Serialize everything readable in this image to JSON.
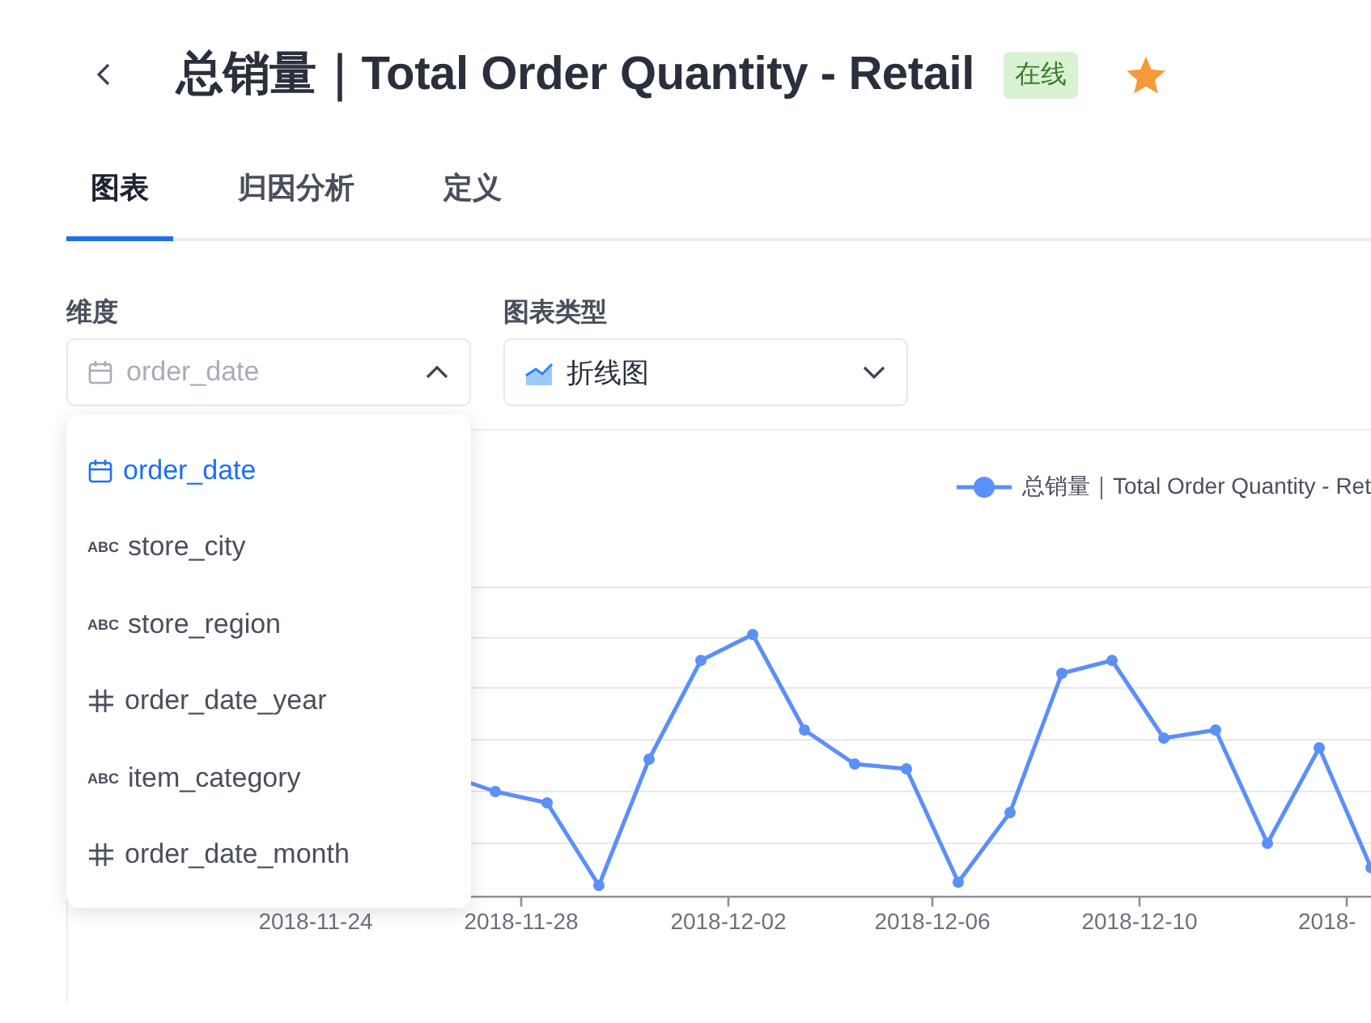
{
  "header": {
    "title": "总销量｜Total Order Quantity - Retail",
    "status_badge": "在线",
    "favorited": true
  },
  "tabs": [
    {
      "label": "图表",
      "selected": true
    },
    {
      "label": "归因分析",
      "selected": false
    },
    {
      "label": "定义",
      "selected": false
    }
  ],
  "dimension": {
    "label": "维度",
    "value": "order_date",
    "kind": "date",
    "expanded": true,
    "options": [
      {
        "kind": "date",
        "label": "order_date",
        "selected": true
      },
      {
        "kind": "text",
        "type_icon": "ABC",
        "label": "store_city",
        "selected": false
      },
      {
        "kind": "text",
        "type_icon": "ABC",
        "label": "store_region",
        "selected": false
      },
      {
        "kind": "number",
        "label": "order_date_year",
        "selected": false
      },
      {
        "kind": "text",
        "type_icon": "ABC",
        "label": "item_category",
        "selected": false
      },
      {
        "kind": "number",
        "label": "order_date_month",
        "selected": false
      }
    ]
  },
  "chart_type": {
    "label": "图表类型",
    "value": "折线图",
    "expanded": false
  },
  "chart": {
    "legend": "总销量｜Total Order Quantity - Ret",
    "x_tick_labels": [
      "2018-11-24",
      "2018-11-28",
      "2018-12-02",
      "2018-12-06",
      "2018-12-10",
      "2018-"
    ]
  }
}
